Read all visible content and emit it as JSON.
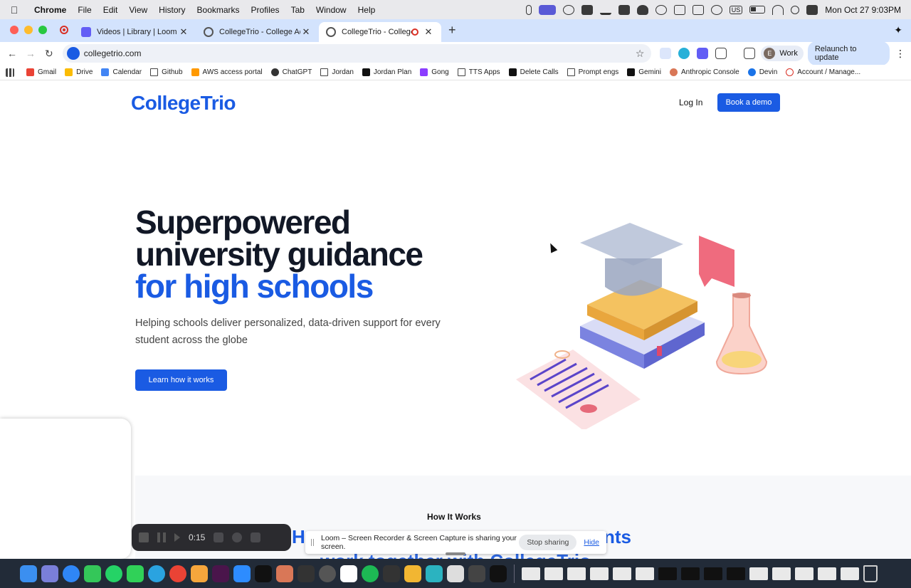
{
  "menubar": {
    "app": "Chrome",
    "items": [
      "File",
      "Edit",
      "View",
      "History",
      "Bookmarks",
      "Profiles",
      "Tab",
      "Window",
      "Help"
    ],
    "input_badge": "US",
    "clock": "Mon Oct 27  9:03PM"
  },
  "tabs": [
    {
      "title": "Videos | Library | Loom",
      "icon": "loom-icon"
    },
    {
      "title": "CollegeTrio - College Admissi",
      "icon": "globe-icon"
    },
    {
      "title": "CollegeTrio - College Adm",
      "icon": "globe-icon",
      "active": true
    }
  ],
  "address": {
    "url": "collegetrio.com",
    "profile_initial": "E",
    "profile_name": "Work",
    "relaunch": "Relaunch to update"
  },
  "bookmarks": [
    {
      "label": "Gmail",
      "icon": "gmail-icon",
      "color": "#ea4335"
    },
    {
      "label": "Drive",
      "icon": "drive-icon",
      "color": "#fbbc04"
    },
    {
      "label": "Calendar",
      "icon": "calendar-icon",
      "color": "#4285f4"
    },
    {
      "label": "Github",
      "icon": "folder-icon"
    },
    {
      "label": "AWS access portal",
      "icon": "aws-icon",
      "color": "#ff9900"
    },
    {
      "label": "ChatGPT",
      "icon": "chatgpt-icon",
      "color": "#333333"
    },
    {
      "label": "Jordan",
      "icon": "folder-icon"
    },
    {
      "label": "Jordan Plan",
      "icon": "notion-icon",
      "color": "#111111"
    },
    {
      "label": "Gong",
      "icon": "gong-icon",
      "color": "#8b3dff"
    },
    {
      "label": "TTS Apps",
      "icon": "folder-icon"
    },
    {
      "label": "Delete Calls",
      "icon": "x-icon",
      "color": "#111111"
    },
    {
      "label": "Prompt engs",
      "icon": "folder-icon"
    },
    {
      "label": "Gemini",
      "icon": "gemini-icon",
      "color": "#111111"
    },
    {
      "label": "Anthropic Console",
      "icon": "anthropic-icon",
      "color": "#d97757"
    },
    {
      "label": "Devin",
      "icon": "devin-icon",
      "color": "#1a73e8"
    },
    {
      "label": "Account / Manage...",
      "icon": "account-icon",
      "color": "#d93025"
    }
  ],
  "site": {
    "logo": "CollegeTrio",
    "login": "Log In",
    "book_demo": "Book a demo",
    "hero_line1": "Superpowered",
    "hero_line2": "university guidance",
    "hero_line3": "for high schools",
    "hero_sub": "Helping schools deliver personalized, data-driven support for every student across the globe",
    "cta": "Learn how it works",
    "how_label": "How It Works",
    "frag1": "Ho",
    "frag2": "nts",
    "frag3": "work together with CollegeTrio"
  },
  "loom": {
    "timer": "0:15",
    "share_msg": "Loom – Screen Recorder & Screen Capture is sharing your screen.",
    "stop_sharing": "Stop sharing",
    "hide": "Hide"
  },
  "colors": {
    "brand_blue": "#1a5be3",
    "heading_dark": "#121826"
  }
}
